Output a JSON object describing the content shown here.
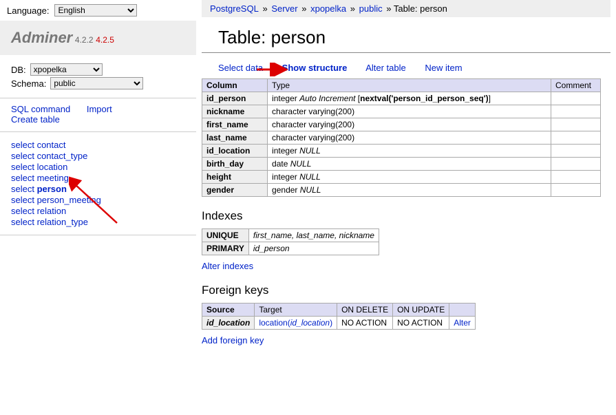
{
  "language": {
    "label": "Language:",
    "value": "English"
  },
  "brand": {
    "name": "Adminer",
    "version": "4.2.2",
    "latest": "4.2.5"
  },
  "db": {
    "label": "DB:",
    "value": "xpopelka"
  },
  "schema": {
    "label": "Schema:",
    "value": "public"
  },
  "commands": {
    "sql": "SQL command",
    "import": "Import",
    "create": "Create table"
  },
  "tables": {
    "prefix": "select",
    "items": [
      "contact",
      "contact_type",
      "location",
      "meeting",
      "person",
      "person_meeting",
      "relation",
      "relation_type"
    ],
    "current": "person"
  },
  "breadcrumb": {
    "sep": "»",
    "p1": "PostgreSQL",
    "p2": "Server",
    "p3": "xpopelka",
    "p4": "public",
    "last": "Table: person"
  },
  "title": "Table: person",
  "actions": {
    "select_data": "Select data",
    "show_structure": "Show structure",
    "alter_table": "Alter table",
    "new_item": "New item"
  },
  "structure": {
    "headers": {
      "column": "Column",
      "type": "Type",
      "comment": "Comment"
    },
    "rows": [
      {
        "name": "id_person",
        "type_pre": "integer ",
        "type_em": "Auto Increment",
        "type_post": " [",
        "type_bold": "nextval('person_id_person_seq')",
        "type_end": "]"
      },
      {
        "name": "nickname",
        "type_pre": "character varying(200)"
      },
      {
        "name": "first_name",
        "type_pre": "character varying(200)"
      },
      {
        "name": "last_name",
        "type_pre": "character varying(200)"
      },
      {
        "name": "id_location",
        "type_pre": "integer ",
        "type_em": "NULL"
      },
      {
        "name": "birth_day",
        "type_pre": "date ",
        "type_em": "NULL"
      },
      {
        "name": "height",
        "type_pre": "integer ",
        "type_em": "NULL"
      },
      {
        "name": "gender",
        "type_pre": "gender ",
        "type_em": "NULL"
      }
    ]
  },
  "indexes": {
    "title": "Indexes",
    "rows": [
      {
        "kind": "UNIQUE",
        "cols": "first_name, last_name, nickname"
      },
      {
        "kind": "PRIMARY",
        "cols": "id_person"
      }
    ],
    "alter": "Alter indexes"
  },
  "fk": {
    "title": "Foreign keys",
    "headers": {
      "source": "Source",
      "target": "Target",
      "ondel": "ON DELETE",
      "onupd": "ON UPDATE"
    },
    "rows": [
      {
        "source": "id_location",
        "target_pre": "location(",
        "target_em": "id_location",
        "target_post": ")",
        "ondel": "NO ACTION",
        "onupd": "NO ACTION",
        "alter": "Alter"
      }
    ],
    "add": "Add foreign key"
  }
}
